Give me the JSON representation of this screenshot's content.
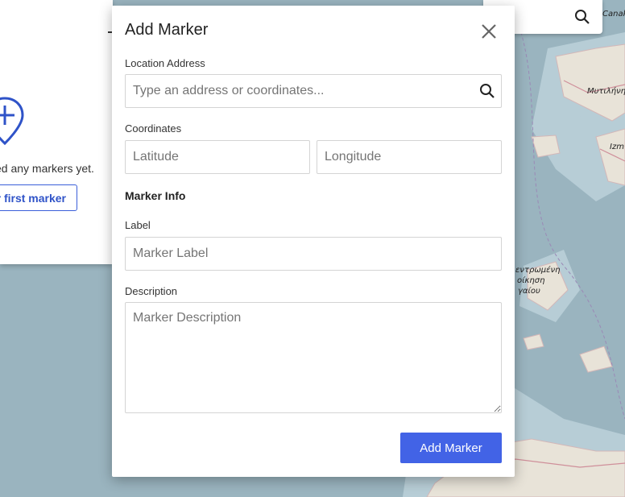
{
  "background": {
    "empty_text": "ed any markers yet.",
    "first_marker_button": "r first marker",
    "map_labels": {
      "city1": "Μυτιλήνη",
      "city2": "Izm",
      "city3": "Canak",
      "region1": "εντρωμένη",
      "region2": "οίκηση",
      "region3": "γαίου"
    }
  },
  "dialog": {
    "title": "Add Marker",
    "location": {
      "label": "Location Address",
      "placeholder": "Type an address or coordinates...",
      "value": ""
    },
    "coordinates": {
      "label": "Coordinates",
      "latitude_placeholder": "Latitude",
      "longitude_placeholder": "Longitude",
      "latitude_value": "",
      "longitude_value": ""
    },
    "marker_info": {
      "section_title": "Marker Info",
      "label_label": "Label",
      "label_placeholder": "Marker Label",
      "description_label": "Description",
      "description_placeholder": "Marker Description"
    },
    "submit_label": "Add Marker"
  },
  "colors": {
    "primary": "#4263e6",
    "sea": "#9ab4bf",
    "land": "#e8e3d8"
  },
  "icons": {
    "close": "close-icon",
    "search": "search-icon",
    "add_pin": "map-pin-plus-icon"
  }
}
